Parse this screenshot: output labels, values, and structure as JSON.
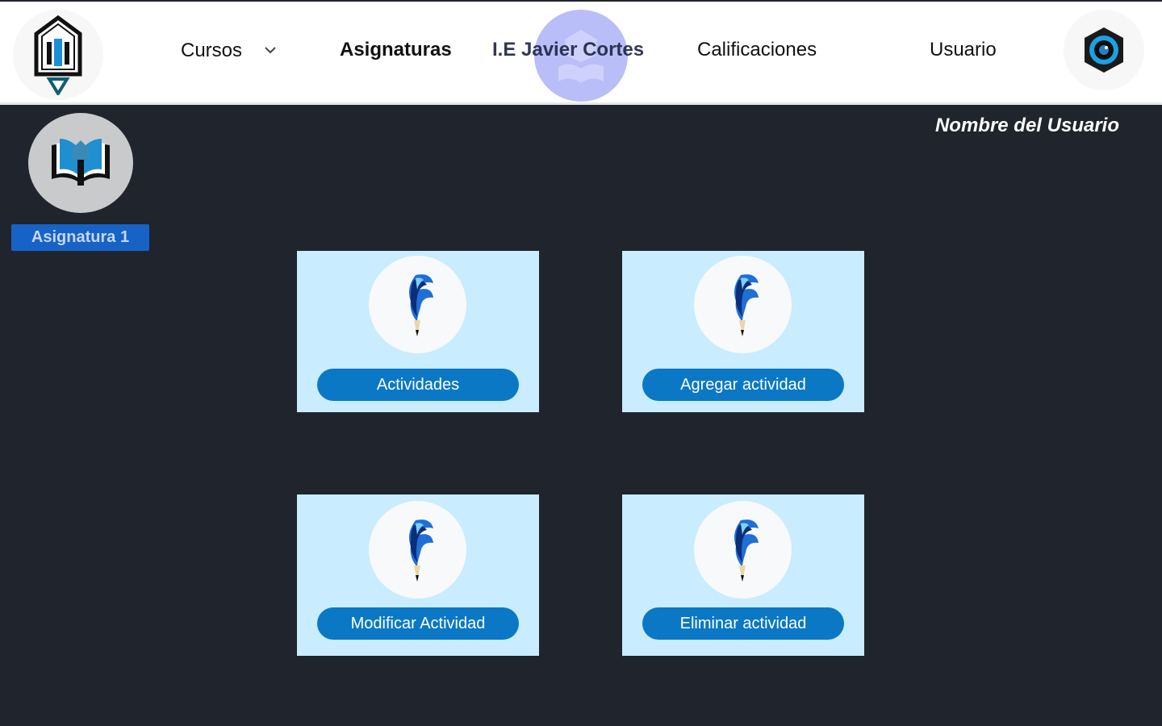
{
  "header": {
    "nav": {
      "cursos": "Cursos",
      "asignaturas": "Asignaturas",
      "calificaciones": "Calificaciones",
      "usuario": "Usuario"
    },
    "school_name": "I.E Javier Cortes"
  },
  "user": {
    "name": "Nombre del Usuario"
  },
  "subject": {
    "label": "Asignatura 1"
  },
  "cards": [
    {
      "label": "Actividades",
      "icon": "pencil-feather-icon"
    },
    {
      "label": "Agregar actividad",
      "icon": "pencil-feather-icon"
    },
    {
      "label": "Modificar Actividad",
      "icon": "pencil-feather-icon"
    },
    {
      "label": "Eliminar actividad",
      "icon": "pencil-feather-icon"
    }
  ],
  "colors": {
    "background": "#1f242d",
    "card": "#c9ecfe",
    "button": "#0a78c5",
    "badge": "#1762c6"
  }
}
